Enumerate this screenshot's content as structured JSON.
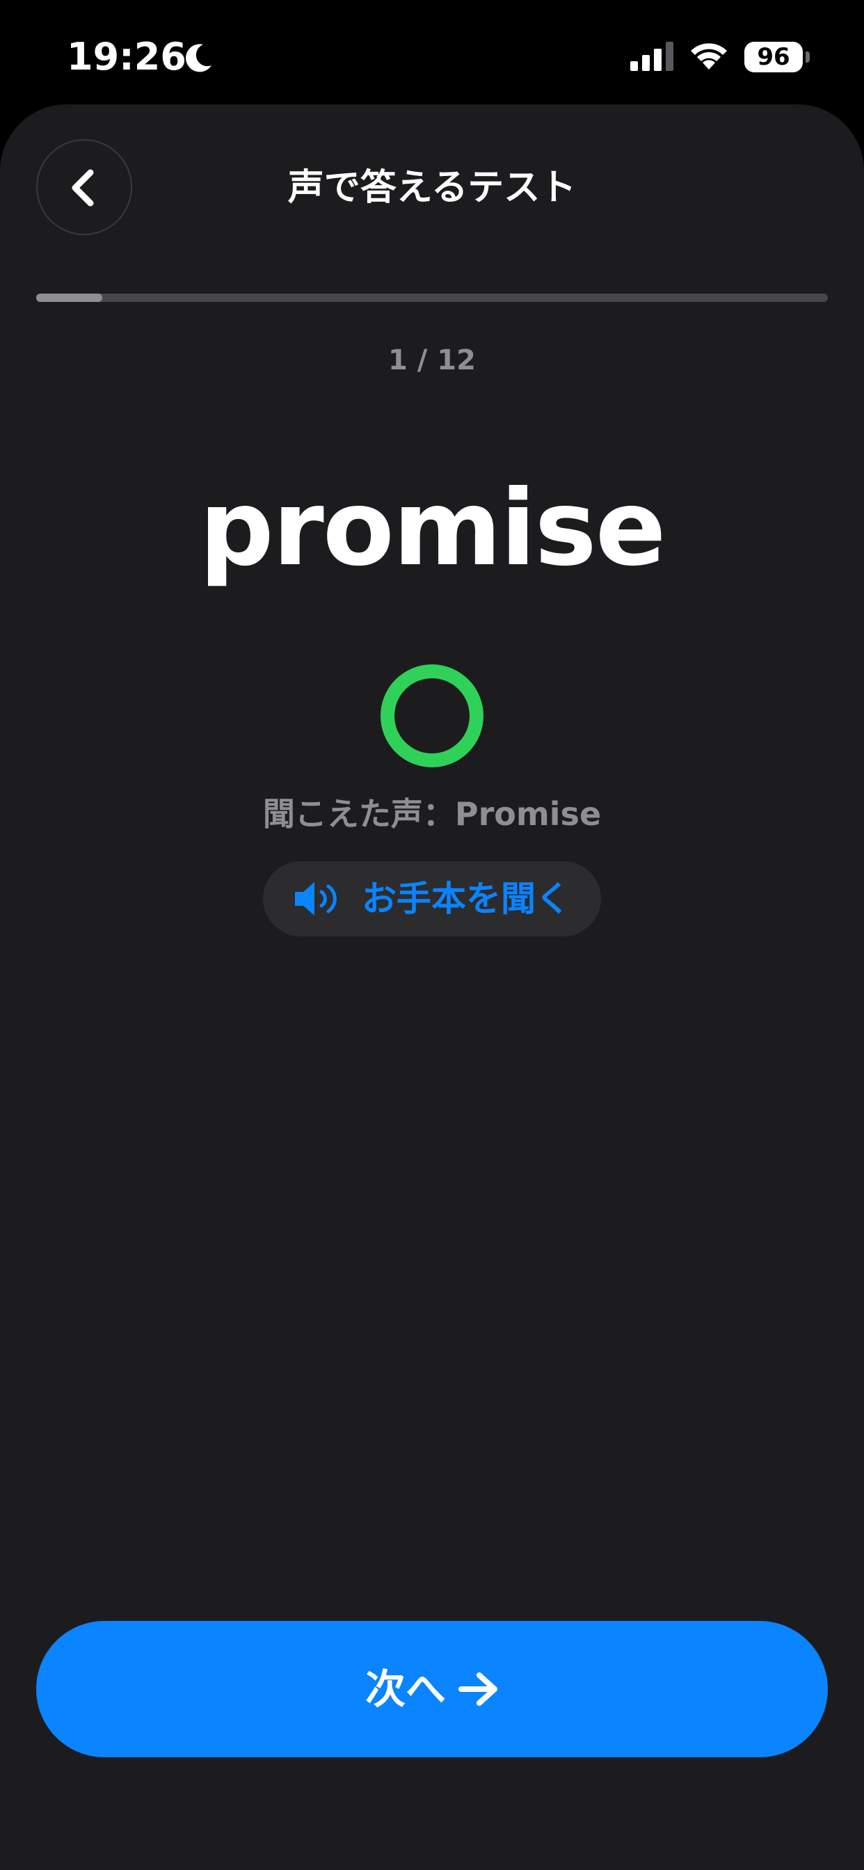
{
  "status_bar": {
    "time": "19:26",
    "battery": "96"
  },
  "header": {
    "title": "声で答えるテスト"
  },
  "progress": {
    "text": "1 / 12",
    "current": 1,
    "total": 12
  },
  "quiz": {
    "word": "promise",
    "result": "correct",
    "heard_text": "聞こえた声：Promise",
    "listen_label": "お手本を聞く"
  },
  "footer": {
    "next_label": "次へ"
  },
  "colors": {
    "accent": "#0a84ff",
    "correct": "#30d158",
    "background": "#1c1c1e"
  },
  "icons": {
    "back": "chevron-left-icon",
    "result": "circle-correct-icon",
    "listen": "speaker-icon",
    "next": "arrow-right-icon"
  }
}
